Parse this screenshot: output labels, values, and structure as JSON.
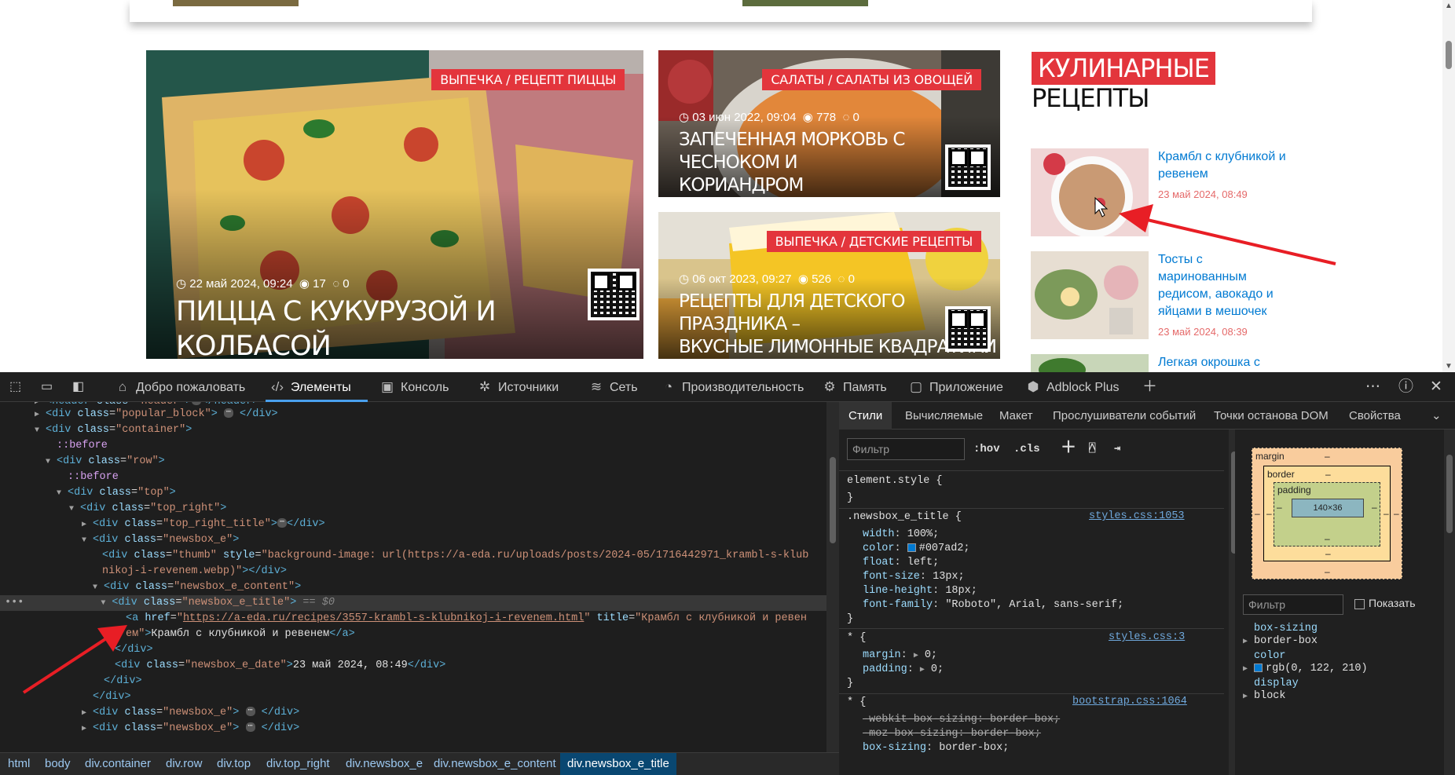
{
  "page": {
    "cards": [
      {
        "category": "ВЫПЕЧКА / РЕЦЕПТ ПИЦЦЫ",
        "date": "22 май 2024, 09:24",
        "views": "17",
        "comments": "0",
        "title": "ПИЦЦА С КУКУРУЗОЙ И КОЛБАСОЙ"
      },
      {
        "category": "САЛАТЫ / САЛАТЫ ИЗ ОВОЩЕЙ",
        "date": "03 июн 2022, 09:04",
        "views": "778",
        "comments": "0",
        "title_l1": "ЗАПЕЧЕННАЯ МОРКОВЬ С ЧЕСНОКОМ И",
        "title_l2": "КОРИАНДРОМ"
      },
      {
        "category": "ВЫПЕЧКА / ДЕТСКИЕ РЕЦЕПТЫ",
        "date": "06 окт 2023, 09:27",
        "views": "526",
        "comments": "0",
        "title_l1": "РЕЦЕПТЫ ДЛЯ ДЕТСКОГО ПРАЗДНИКА –",
        "title_l2": "ВКУСНЫЕ ЛИМОННЫЕ КВАДРАТИКИ"
      }
    ],
    "sidebar": {
      "heading1": "КУЛИНАРНЫЕ",
      "heading2": "РЕЦЕПТЫ",
      "items": [
        {
          "title_l1": "Крамбл с клубникой и",
          "title_l2": "ревенем",
          "date": "23 май 2024, 08:49"
        },
        {
          "title_l1": "Тосты с",
          "title_l2": "маринованным",
          "title_l3": "редисом, авокадо и",
          "title_l4": "яйцами в мешочек",
          "date": "23 май 2024, 08:39"
        },
        {
          "title_l1": "Легкая окрошка с"
        }
      ]
    }
  },
  "devtools": {
    "tabs": [
      "Добро пожаловать",
      "Элементы",
      "Консоль",
      "Источники",
      "Сеть",
      "Производительность",
      "Память",
      "Приложение",
      "Adblock Plus"
    ],
    "active_tab": "Элементы",
    "dom": {
      "l0": "<header class=\"header\">",
      "l0b": "</header>",
      "popular": "popular_block",
      "container": "container",
      "before": "::before",
      "row": "row",
      "top": "top",
      "top_right": "top_right",
      "top_right_title": "top_right_title",
      "newsbox_e": "newsbox_e",
      "thumb": "thumb",
      "thumb_style_1": "background-image: url(https://a-eda.ru/uploads/posts/2024-05/1716442971_krambl-s-klub",
      "thumb_style_2": "nikoj-i-revenem.webp)",
      "newsbox_e_content": "newsbox_e_content",
      "newsbox_e_title": "newsbox_e_title",
      "eq0": "== $0",
      "href": "https://a-eda.ru/recipes/3557-krambl-s-klubnikoj-i-revenem.html",
      "a_title_1": "Крамбл с клубникой и ревен",
      "a_title_2": "ем",
      "a_text": "Крамбл с клубникой и ревенем",
      "newsbox_e_date": "newsbox_e_date",
      "date_text": "23 май 2024, 08:49"
    },
    "breadcrumbs": [
      "html",
      "body",
      "div.container",
      "div.row",
      "div.top",
      "div.top_right",
      "div.newsbox_e",
      "div.newsbox_e_content",
      "div.newsbox_e_title"
    ],
    "style_tabs": [
      "Стили",
      "Вычисляемые",
      "Макет",
      "Прослушиватели событий",
      "Точки останова DOM",
      "Свойства"
    ],
    "filter_placeholder": "Фильтр",
    "hov": ":hov",
    "cls": ".cls",
    "styles": {
      "element_style": "element.style {",
      "close": "}",
      "rule1_selector": ".newsbox_e_title {",
      "rule1_source": "styles.css:1053",
      "rule1_props": [
        {
          "name": "width",
          "value": "100%;"
        },
        {
          "name": "color",
          "value": "#007ad2;"
        },
        {
          "name": "float",
          "value": "left;"
        },
        {
          "name": "font-size",
          "value": "13px;"
        },
        {
          "name": "line-height",
          "value": "18px;"
        },
        {
          "name": "font-family",
          "value": "\"Roboto\", Arial, sans-serif;"
        }
      ],
      "rule2_selector": "* {",
      "rule2_source": "styles.css:3",
      "rule2_props": [
        {
          "name": "margin",
          "value": "0;"
        },
        {
          "name": "padding",
          "value": "0;"
        }
      ],
      "rule3_selector": "* {",
      "rule3_source": "bootstrap.css:1064",
      "rule3_props": [
        {
          "name": "-webkit-box-sizing",
          "value": "border-box;"
        },
        {
          "name": "-moz-box-sizing",
          "value": "border-box;"
        },
        {
          "name": "box-sizing",
          "value": "border-box;"
        }
      ]
    },
    "boxmodel": {
      "margin": "margin",
      "border": "border",
      "padding": "padding",
      "content": "140×36",
      "dash": "–"
    },
    "computed": {
      "filter_placeholder": "Фильтр",
      "show_all": "Показать",
      "items": [
        {
          "name": "box-sizing",
          "value": "border-box"
        },
        {
          "name": "color",
          "value": "rgb(0, 122, 210)"
        },
        {
          "name": "display",
          "value": "block"
        }
      ]
    },
    "accent_color": "#007ad2"
  }
}
